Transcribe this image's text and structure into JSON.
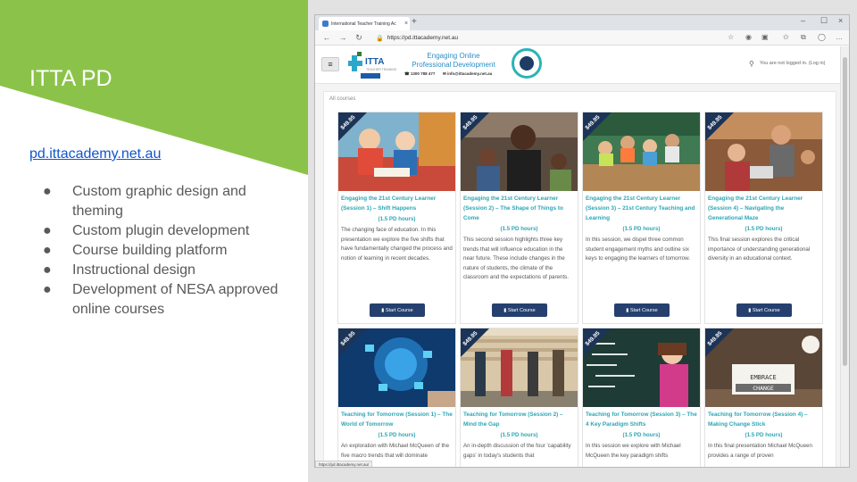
{
  "slide": {
    "title": "ITTA PD",
    "link": "pd.ittacademy.net.au",
    "bullets": [
      "Custom graphic design and theming",
      "Custom plugin development",
      "Course building platform",
      "Instructional design",
      "Development of NESA approved online courses"
    ],
    "colors": {
      "accent": "#8bc34a",
      "link": "#1155cc",
      "bullet_text": "#595959"
    }
  },
  "browser": {
    "tab_title": "International Teacher Training Ac",
    "url": "https://pd.ittacademy.net.au",
    "status_url": "https://pd.ittacademy.net.au/"
  },
  "site": {
    "logo_text": "ITTA",
    "logo_sub": "TEACHER TRAINING",
    "tagline_line1": "Engaging Online",
    "tagline_line2": "Professional Development",
    "phone": "1300 788 477",
    "email": "info@ittacademy.net.au",
    "login_text": "You are not logged in. (Log in)",
    "section_label": "All courses"
  },
  "courses": [
    {
      "price": "$49.95",
      "title": "Engaging the 21st Century Learner (Session 1) – Shift Happens",
      "hours": "(1.5 PD hours)",
      "description": "The changing face of education. In this presentation we explore the five shifts that have fundamentally changed the process and notion of learning in recent decades.",
      "button": "Start Course"
    },
    {
      "price": "$49.95",
      "title": "Engaging the 21st Century Learner (Session 2) – The Shape of Things to Come",
      "hours": "(1.5 PD hours)",
      "description": "This second session highlights three key trends that will influence education in the near future. These include changes in the nature of students, the climate of the classroom and the expectations of parents.",
      "button": "Start Course"
    },
    {
      "price": "$49.95",
      "title": "Engaging the 21st Century Learner (Session 3) – 21st Century Teaching and Learning",
      "hours": "(1.5 PD hours)",
      "description": "In this session, we dispel three common student engagement myths and outline six keys to engaging the learners of tomorrow.",
      "button": "Start Course"
    },
    {
      "price": "$49.95",
      "title": "Engaging the 21st Century Learner (Session 4) – Navigating the Generational Maze",
      "hours": "(1.5 PD hours)",
      "description": "This final session explores the critical importance of understanding generational diversity in an educational context.",
      "button": "Start Course"
    },
    {
      "price": "$49.95",
      "title": "Teaching for Tomorrow (Session 1) – The World of Tomorrow",
      "hours": "(1.5 PD hours)",
      "description": "An exploration with Michael McQueen of the five macro trends that will dominate",
      "button": ""
    },
    {
      "price": "$49.95",
      "title": "Teaching for Tomorrow (Session 2) – Mind the Gap",
      "hours": "(1.5 PD hours)",
      "description": "An in-depth discussion of the four 'capability gaps' in today's students that",
      "button": ""
    },
    {
      "price": "$49.95",
      "title": "Teaching for Tomorrow (Session 3) – The 4 Key Paradigm Shifts",
      "hours": "(1.5 PD hours)",
      "description": "In this session we explore with Michael McQueen the key paradigm shifts",
      "button": ""
    },
    {
      "price": "$49.95",
      "title": "Teaching for Tomorrow (Session 4) – Making Change Stick",
      "hours": "(1.5 PD hours)",
      "description": "In this final presentation Michael McQueen provides a range of proven",
      "button": ""
    }
  ],
  "image_text": {
    "embrace": "EMBRACE",
    "change": "CHANGE"
  },
  "icons": {
    "hamburger": "menu-icon",
    "search": "search-icon",
    "back": "back-arrow-icon",
    "forward": "forward-arrow-icon",
    "refresh": "refresh-icon",
    "lock": "lock-icon",
    "star": "star-icon",
    "book": "book-icon"
  }
}
